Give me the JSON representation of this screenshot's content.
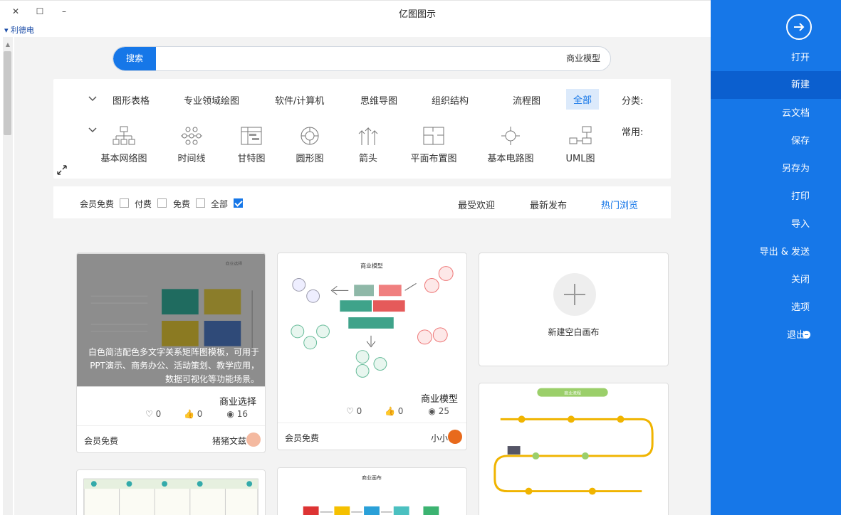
{
  "window": {
    "title": "亿图图示",
    "close": "✕",
    "maximize": "☐",
    "minimize": "–",
    "user": "利德电"
  },
  "sidebar": {
    "open_icon": "arrow-circle-icon",
    "items": [
      {
        "label": "打开"
      },
      {
        "label": "新建"
      },
      {
        "label": "云文档"
      },
      {
        "label": "保存"
      },
      {
        "label": "另存为"
      },
      {
        "label": "打印"
      },
      {
        "label": "导入"
      },
      {
        "label": "导出 & 发送"
      },
      {
        "label": "关闭"
      },
      {
        "label": "选项"
      },
      {
        "label": "退出"
      }
    ],
    "active": "新建",
    "bg_color": "#1677e8"
  },
  "search": {
    "button": "搜索",
    "value": "商业模型"
  },
  "categories": {
    "label": "分类:",
    "items": [
      "全部",
      "流程图",
      "组织结构",
      "思维导图",
      "软件/计算机",
      "专业领域绘图",
      "图形表格"
    ],
    "active": "全部",
    "common_label": "常用:",
    "common": [
      {
        "label": "UML图",
        "icon": "uml-icon"
      },
      {
        "label": "基本电路图",
        "icon": "circuit-icon"
      },
      {
        "label": "平面布置图",
        "icon": "floorplan-icon"
      },
      {
        "label": "箭头",
        "icon": "arrows-icon"
      },
      {
        "label": "圆形图",
        "icon": "circle-diagram-icon"
      },
      {
        "label": "甘特图",
        "icon": "gantt-icon"
      },
      {
        "label": "时间线",
        "icon": "timeline-icon"
      },
      {
        "label": "基本网络图",
        "icon": "network-icon"
      }
    ]
  },
  "filters": {
    "tabs": [
      "热门浏览",
      "最新发布",
      "最受欢迎"
    ],
    "active_tab": "热门浏览",
    "checks": [
      {
        "label": "全部",
        "checked": true
      },
      {
        "label": "免费",
        "checked": false
      },
      {
        "label": "付费",
        "checked": false
      },
      {
        "label": "会员免费",
        "checked": false
      }
    ]
  },
  "cards": {
    "new_canvas": "新建空白画布",
    "card1": {
      "title": "商业模型",
      "views": "25",
      "likes": "0",
      "favs": "0",
      "author": "小小",
      "price": "会员免费",
      "thumb_title": "商业模型"
    },
    "card2": {
      "title": "商业选择",
      "views": "16",
      "likes": "0",
      "favs": "0",
      "author": "猪猪文兹",
      "price": "会员免费",
      "overlay": "白色简洁配色多文字关系矩阵图模板，可用于PPT演示、商务办公、活动策划、教学应用，数据可视化等功能场景。",
      "thumb_title": "商业选择"
    },
    "card3": {
      "thumb_title": "商业流程"
    },
    "card5": {
      "thumb_title": "商业画布"
    }
  }
}
